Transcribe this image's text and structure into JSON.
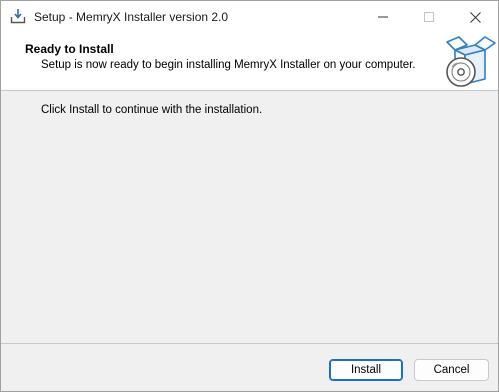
{
  "window": {
    "title": "Setup - MemryX Installer version 2.0"
  },
  "header": {
    "title": "Ready to Install",
    "subtitle": "Setup is now ready to begin installing MemryX Installer on your computer."
  },
  "main": {
    "instruction": "Click Install to continue with the installation."
  },
  "buttons": {
    "install_label": "Install",
    "cancel_label": "Cancel"
  },
  "icons": {
    "app": "installer-download-icon",
    "header": "box-with-disc-icon",
    "minimize": "minimize-icon",
    "maximize": "maximize-icon",
    "close": "close-icon"
  },
  "colors": {
    "accent": "#1a6fc4",
    "header_graphic": "#2f7fc1"
  }
}
